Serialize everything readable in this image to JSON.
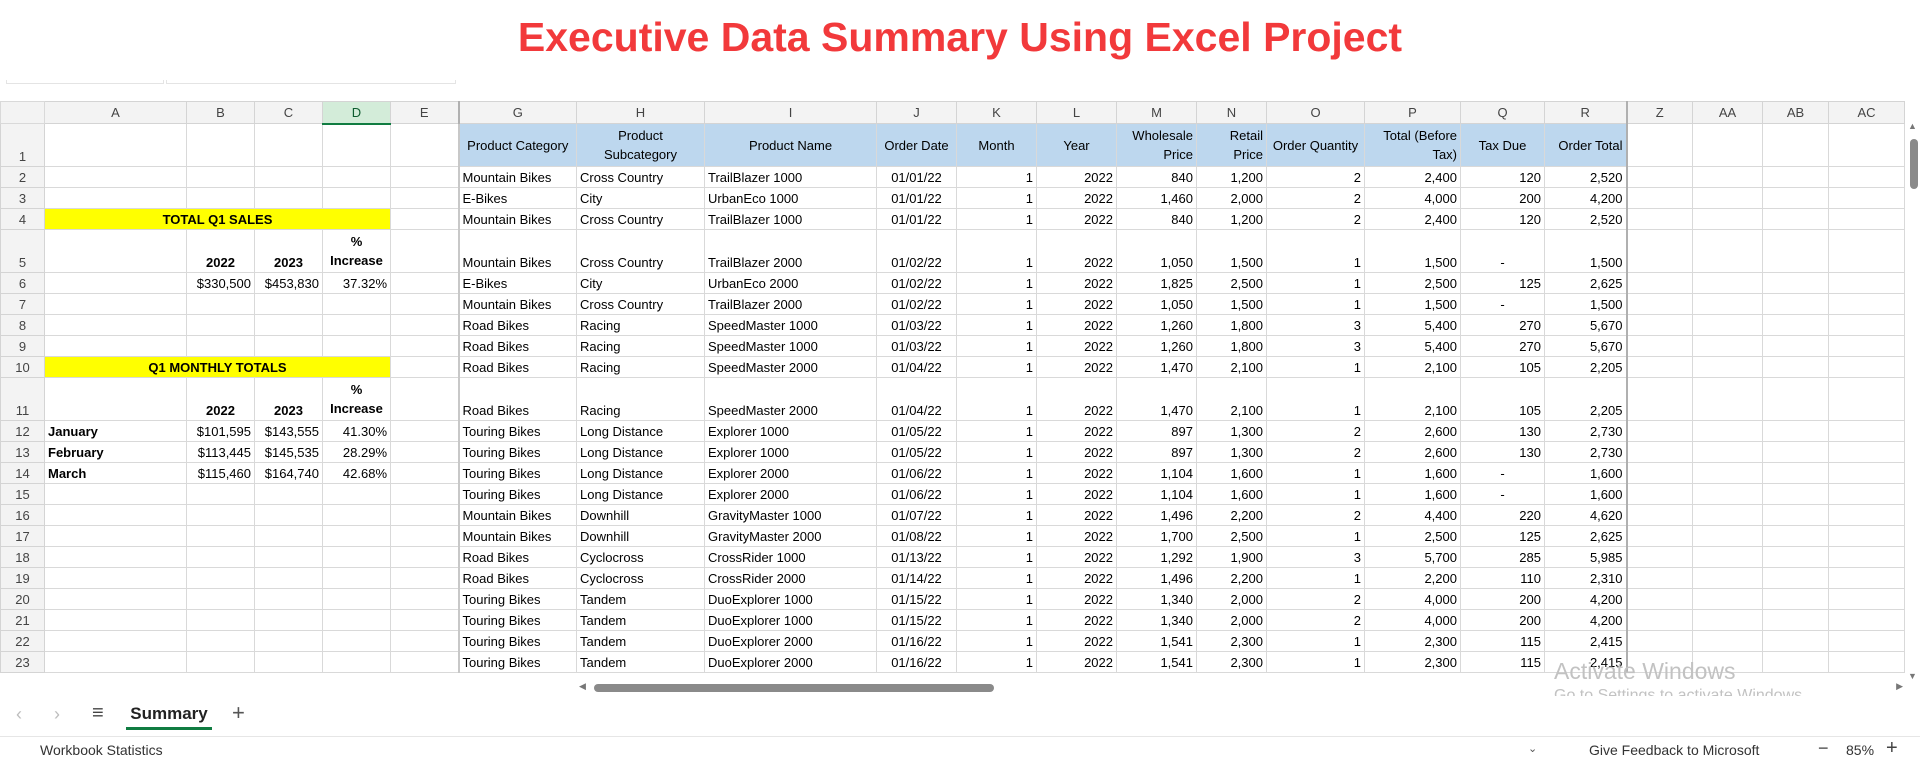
{
  "title": "Executive Data Summary Using Excel Project",
  "columns": [
    "A",
    "B",
    "C",
    "D",
    "E",
    "G",
    "H",
    "I",
    "J",
    "K",
    "L",
    "M",
    "N",
    "O",
    "P",
    "Q",
    "R",
    "Z",
    "AA",
    "AB",
    "AC"
  ],
  "selected_column": "D",
  "row_numbers": [
    "1",
    "2",
    "3",
    "4",
    "5",
    "6",
    "7",
    "8",
    "9",
    "10",
    "11",
    "12",
    "13",
    "14",
    "15",
    "16",
    "17",
    "18",
    "19",
    "20",
    "21",
    "22",
    "23"
  ],
  "summary": {
    "total_q1_label": "TOTAL Q1 SALES",
    "year_2022": "2022",
    "year_2023": "2023",
    "pct_increase": "% Increase",
    "total_2022": "$330,500",
    "total_2023": "$453,830",
    "total_pct": "37.32%",
    "monthly_label": "Q1 MONTHLY TOTALS",
    "months": [
      {
        "month": "January",
        "v2022": "$101,595",
        "v2023": "$143,555",
        "pct": "41.30%"
      },
      {
        "month": "February",
        "v2022": "$113,445",
        "v2023": "$145,535",
        "pct": "28.29%"
      },
      {
        "month": "March",
        "v2022": "$115,460",
        "v2023": "$164,740",
        "pct": "42.68%"
      }
    ]
  },
  "table_headers": [
    "Product Category",
    "Product Subcategory",
    "Product Name",
    "Order Date",
    "Month",
    "Year",
    "Wholesale Price",
    "Retail Price",
    "Order Quantity",
    "Total (Before Tax)",
    "Tax Due",
    "Order Total"
  ],
  "rows": [
    [
      "Mountain Bikes",
      "Cross Country",
      "TrailBlazer 1000",
      "01/01/22",
      "1",
      "2022",
      "840",
      "1,200",
      "2",
      "2,400",
      "120",
      "2,520"
    ],
    [
      "E-Bikes",
      "City",
      "UrbanEco 1000",
      "01/01/22",
      "1",
      "2022",
      "1,460",
      "2,000",
      "2",
      "4,000",
      "200",
      "4,200"
    ],
    [
      "Mountain Bikes",
      "Cross Country",
      "TrailBlazer 1000",
      "01/01/22",
      "1",
      "2022",
      "840",
      "1,200",
      "2",
      "2,400",
      "120",
      "2,520"
    ],
    [
      "Mountain Bikes",
      "Cross Country",
      "TrailBlazer 2000",
      "01/02/22",
      "1",
      "2022",
      "1,050",
      "1,500",
      "1",
      "1,500",
      "-",
      "1,500"
    ],
    [
      "E-Bikes",
      "City",
      "UrbanEco 2000",
      "01/02/22",
      "1",
      "2022",
      "1,825",
      "2,500",
      "1",
      "2,500",
      "125",
      "2,625"
    ],
    [
      "Mountain Bikes",
      "Cross Country",
      "TrailBlazer 2000",
      "01/02/22",
      "1",
      "2022",
      "1,050",
      "1,500",
      "1",
      "1,500",
      "-",
      "1,500"
    ],
    [
      "Road Bikes",
      "Racing",
      "SpeedMaster 1000",
      "01/03/22",
      "1",
      "2022",
      "1,260",
      "1,800",
      "3",
      "5,400",
      "270",
      "5,670"
    ],
    [
      "Road Bikes",
      "Racing",
      "SpeedMaster 1000",
      "01/03/22",
      "1",
      "2022",
      "1,260",
      "1,800",
      "3",
      "5,400",
      "270",
      "5,670"
    ],
    [
      "Road Bikes",
      "Racing",
      "SpeedMaster 2000",
      "01/04/22",
      "1",
      "2022",
      "1,470",
      "2,100",
      "1",
      "2,100",
      "105",
      "2,205"
    ],
    [
      "Road Bikes",
      "Racing",
      "SpeedMaster 2000",
      "01/04/22",
      "1",
      "2022",
      "1,470",
      "2,100",
      "1",
      "2,100",
      "105",
      "2,205"
    ],
    [
      "Touring Bikes",
      "Long Distance",
      "Explorer 1000",
      "01/05/22",
      "1",
      "2022",
      "897",
      "1,300",
      "2",
      "2,600",
      "130",
      "2,730"
    ],
    [
      "Touring Bikes",
      "Long Distance",
      "Explorer 1000",
      "01/05/22",
      "1",
      "2022",
      "897",
      "1,300",
      "2",
      "2,600",
      "130",
      "2,730"
    ],
    [
      "Touring Bikes",
      "Long Distance",
      "Explorer 2000",
      "01/06/22",
      "1",
      "2022",
      "1,104",
      "1,600",
      "1",
      "1,600",
      "-",
      "1,600"
    ],
    [
      "Touring Bikes",
      "Long Distance",
      "Explorer 2000",
      "01/06/22",
      "1",
      "2022",
      "1,104",
      "1,600",
      "1",
      "1,600",
      "-",
      "1,600"
    ],
    [
      "Mountain Bikes",
      "Downhill",
      "GravityMaster 1000",
      "01/07/22",
      "1",
      "2022",
      "1,496",
      "2,200",
      "2",
      "4,400",
      "220",
      "4,620"
    ],
    [
      "Mountain Bikes",
      "Downhill",
      "GravityMaster 2000",
      "01/08/22",
      "1",
      "2022",
      "1,700",
      "2,500",
      "1",
      "2,500",
      "125",
      "2,625"
    ],
    [
      "Road Bikes",
      "Cyclocross",
      "CrossRider 1000",
      "01/13/22",
      "1",
      "2022",
      "1,292",
      "1,900",
      "3",
      "5,700",
      "285",
      "5,985"
    ],
    [
      "Road Bikes",
      "Cyclocross",
      "CrossRider 2000",
      "01/14/22",
      "1",
      "2022",
      "1,496",
      "2,200",
      "1",
      "2,200",
      "110",
      "2,310"
    ],
    [
      "Touring Bikes",
      "Tandem",
      "DuoExplorer 1000",
      "01/15/22",
      "1",
      "2022",
      "1,340",
      "2,000",
      "2",
      "4,000",
      "200",
      "4,200"
    ],
    [
      "Touring Bikes",
      "Tandem",
      "DuoExplorer 1000",
      "01/15/22",
      "1",
      "2022",
      "1,340",
      "2,000",
      "2",
      "4,000",
      "200",
      "4,200"
    ],
    [
      "Touring Bikes",
      "Tandem",
      "DuoExplorer 2000",
      "01/16/22",
      "1",
      "2022",
      "1,541",
      "2,300",
      "1",
      "2,300",
      "115",
      "2,415"
    ],
    [
      "Touring Bikes",
      "Tandem",
      "DuoExplorer 2000",
      "01/16/22",
      "1",
      "2022",
      "1,541",
      "2,300",
      "1",
      "2,300",
      "115",
      "2,415"
    ]
  ],
  "sheet_tab": "Summary",
  "status": {
    "workbook_stats": "Workbook Statistics",
    "feedback": "Give Feedback to Microsoft",
    "zoom": "85%"
  },
  "watermark": {
    "line1": "Activate Windows",
    "line2": "Go to Settings to activate Windows."
  },
  "icons": {
    "tab_prev": "chevron-left-icon",
    "tab_next": "chevron-right-icon",
    "sheet_menu": "hamburger-menu-icon",
    "add_sheet": "plus-icon",
    "zoom_out": "minus-icon",
    "zoom_in": "plus-icon"
  },
  "colors": {
    "title": "#f2393b",
    "header_fill": "#bdd7ee",
    "highlight": "#ffff00",
    "accent": "#107c41"
  }
}
